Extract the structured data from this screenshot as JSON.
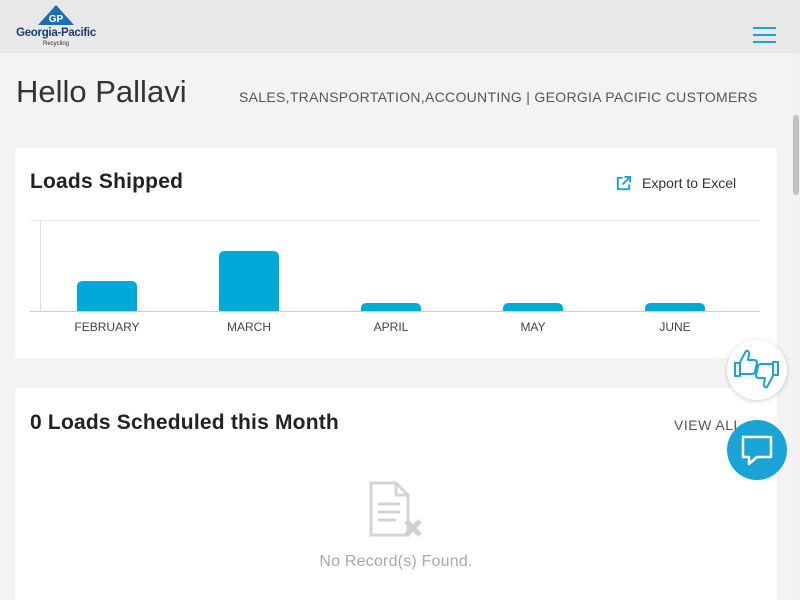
{
  "header": {
    "logo_name": "Georgia-Pacific",
    "logo_sub": "Recycling",
    "logo_mark": "GP",
    "menu_icon": "hamburger-menu-icon",
    "accent_color": "#1aa3d6"
  },
  "greeting": "Hello Pallavi",
  "roles": "SALES,TRANSPORTATION,ACCOUNTING | GEORGIA PACIFIC CUSTOMERS",
  "loads_shipped": {
    "title": "Loads Shipped",
    "export_label": "Export to Excel",
    "export_icon": "external-link-icon"
  },
  "chart_data": {
    "type": "bar",
    "categories": [
      "FEBRUARY",
      "MARCH",
      "APRIL",
      "MAY",
      "JUNE"
    ],
    "values": [
      5,
      10,
      1,
      1,
      1
    ],
    "bar_color": "#00aad8",
    "title": "",
    "xlabel": "",
    "ylabel": "",
    "grid": false
  },
  "scheduled": {
    "title": "0 Loads Scheduled this Month",
    "view_all": "VIEW ALL",
    "empty_icon": "document-remove-icon",
    "empty_text": "No Record(s) Found."
  },
  "floating": {
    "feedback_icon": "thumbs-up-down-icon",
    "chat_icon": "chat-bubble-icon"
  }
}
